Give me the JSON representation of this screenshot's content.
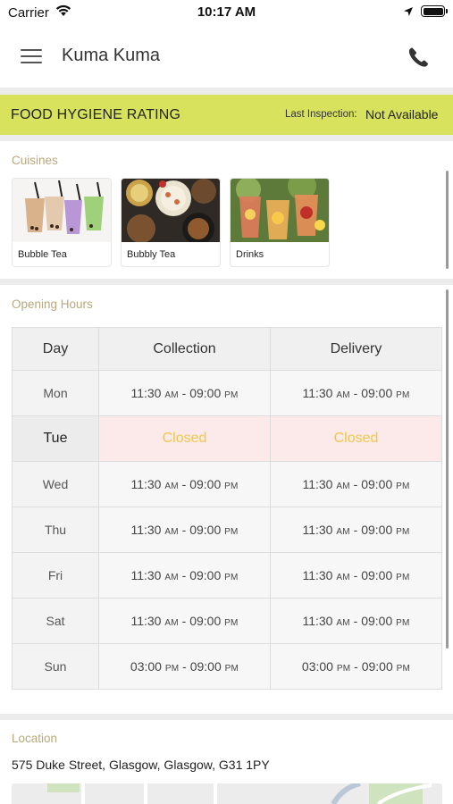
{
  "status_bar": {
    "carrier": "Carrier",
    "time": "10:17 AM"
  },
  "nav": {
    "title": "Kuma Kuma",
    "menu_icon": "hamburger-menu-icon",
    "phone_icon": "phone-icon"
  },
  "hygiene": {
    "title": "FOOD HYGIENE RATING",
    "inspection_label": "Last Inspection:",
    "inspection_value": "Not Available",
    "background": "#d8e25c"
  },
  "cuisines": {
    "heading": "Cuisines",
    "items": [
      {
        "label": "Bubble Tea"
      },
      {
        "label": "Bubbly Tea"
      },
      {
        "label": "Drinks"
      }
    ]
  },
  "opening_hours": {
    "heading": "Opening Hours",
    "columns": [
      "Day",
      "Collection",
      "Delivery"
    ],
    "rows": [
      {
        "day": "Mon",
        "collection": {
          "open": "11:30",
          "open_ampm": "AM",
          "close": "09:00",
          "close_ampm": "PM"
        },
        "delivery": {
          "open": "11:30",
          "open_ampm": "AM",
          "close": "09:00",
          "close_ampm": "PM"
        }
      },
      {
        "day": "Tue",
        "collection": "Closed",
        "delivery": "Closed"
      },
      {
        "day": "Wed",
        "collection": {
          "open": "11:30",
          "open_ampm": "AM",
          "close": "09:00",
          "close_ampm": "PM"
        },
        "delivery": {
          "open": "11:30",
          "open_ampm": "AM",
          "close": "09:00",
          "close_ampm": "PM"
        }
      },
      {
        "day": "Thu",
        "collection": {
          "open": "11:30",
          "open_ampm": "AM",
          "close": "09:00",
          "close_ampm": "PM"
        },
        "delivery": {
          "open": "11:30",
          "open_ampm": "AM",
          "close": "09:00",
          "close_ampm": "PM"
        }
      },
      {
        "day": "Fri",
        "collection": {
          "open": "11:30",
          "open_ampm": "AM",
          "close": "09:00",
          "close_ampm": "PM"
        },
        "delivery": {
          "open": "11:30",
          "open_ampm": "AM",
          "close": "09:00",
          "close_ampm": "PM"
        }
      },
      {
        "day": "Sat",
        "collection": {
          "open": "11:30",
          "open_ampm": "AM",
          "close": "09:00",
          "close_ampm": "PM"
        },
        "delivery": {
          "open": "11:30",
          "open_ampm": "AM",
          "close": "09:00",
          "close_ampm": "PM"
        }
      },
      {
        "day": "Sun",
        "collection": {
          "open": "03:00",
          "open_ampm": "PM",
          "close": "09:00",
          "close_ampm": "PM"
        },
        "delivery": {
          "open": "03:00",
          "open_ampm": "PM",
          "close": "09:00",
          "close_ampm": "PM"
        }
      }
    ]
  },
  "location": {
    "heading": "Location",
    "address": "575 Duke Street, Glasgow, Glasgow, G31 1PY"
  }
}
